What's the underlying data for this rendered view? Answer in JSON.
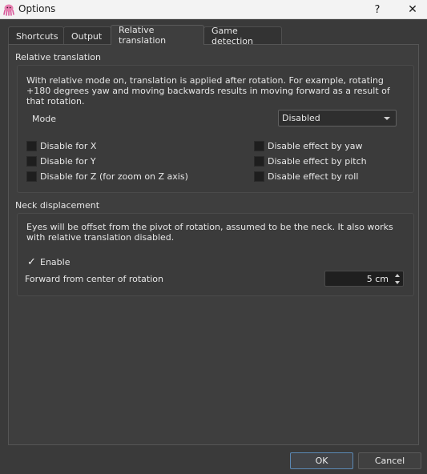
{
  "window": {
    "title": "Options",
    "help_label": "?",
    "close_label": "✕"
  },
  "tabs": [
    {
      "label": "Shortcuts",
      "active": false
    },
    {
      "label": "Output",
      "active": false
    },
    {
      "label": "Relative translation",
      "active": true
    },
    {
      "label": "Game detection",
      "active": false
    }
  ],
  "relative": {
    "title": "Relative translation",
    "description": "With relative mode on, translation is applied after rotation. For example, rotating +180 degrees yaw and moving backwards results in moving forward as a result of that rotation.",
    "mode_label": "Mode",
    "mode_value": "Disabled",
    "checks_left": [
      {
        "label": "Disable for X",
        "checked": false
      },
      {
        "label": "Disable for Y",
        "checked": false
      },
      {
        "label": "Disable for Z (for zoom on Z axis)",
        "checked": false
      }
    ],
    "checks_right": [
      {
        "label": "Disable effect by yaw",
        "checked": false
      },
      {
        "label": "Disable effect by pitch",
        "checked": false
      },
      {
        "label": "Disable effect by roll",
        "checked": false
      }
    ]
  },
  "neck": {
    "title": "Neck displacement",
    "description": "Eyes will be offset from the pivot of rotation, assumed to be the neck. It also works with relative translation disabled.",
    "enable_label": "Enable",
    "enable_checked": true,
    "forward_label": "Forward from center of rotation",
    "forward_value": "5 cm"
  },
  "buttons": {
    "ok": "OK",
    "cancel": "Cancel"
  }
}
